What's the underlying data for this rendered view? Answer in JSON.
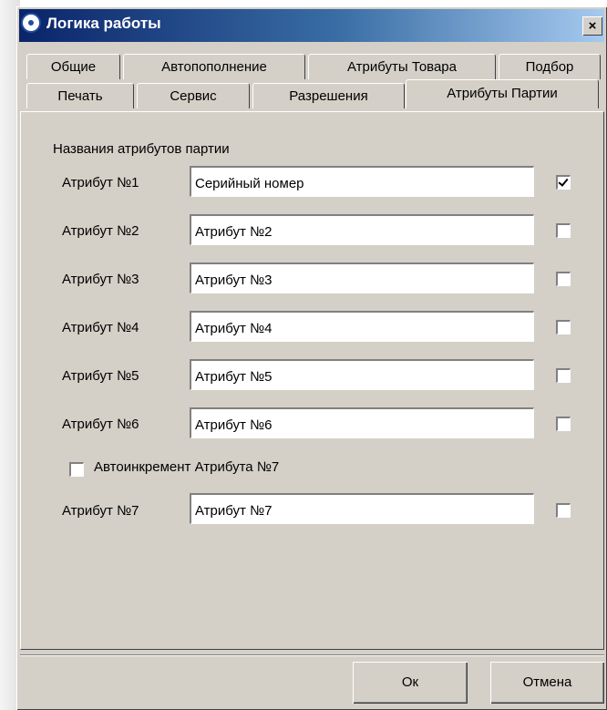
{
  "window": {
    "title": "Логика работы",
    "close_glyph": "×",
    "icon": "app-logo-icon"
  },
  "tabs_row1": [
    "Общие",
    "Автопополнение",
    "Атрибуты Товара",
    "Подбор"
  ],
  "tabs_row2": [
    "Печать",
    "Сервис",
    "Разрешения",
    "Атрибуты Партии"
  ],
  "active_tab": "Атрибуты Партии",
  "section_title": "Названия атрибутов партии",
  "attributes": [
    {
      "label": "Атрибут №1",
      "value": "Серийный номер",
      "checked": true
    },
    {
      "label": "Атрибут №2",
      "value": "Атрибут №2",
      "checked": false
    },
    {
      "label": "Атрибут №3",
      "value": "Атрибут №3",
      "checked": false
    },
    {
      "label": "Атрибут №4",
      "value": "Атрибут №4",
      "checked": false
    },
    {
      "label": "Атрибут №5",
      "value": "Атрибут №5",
      "checked": false
    },
    {
      "label": "Атрибут №6",
      "value": "Атрибут №6",
      "checked": false
    }
  ],
  "autoincrement": {
    "label": "Автоинкремент Атрибута №7",
    "checked": false
  },
  "attribute7": {
    "label": "Атрибут №7",
    "value": "Атрибут №7",
    "checked": false
  },
  "buttons": {
    "ok": "Ок",
    "cancel": "Отмена"
  },
  "colors": {
    "title_start": "#0a246a",
    "title_end": "#a6caf0",
    "face": "#d4d0c8"
  }
}
